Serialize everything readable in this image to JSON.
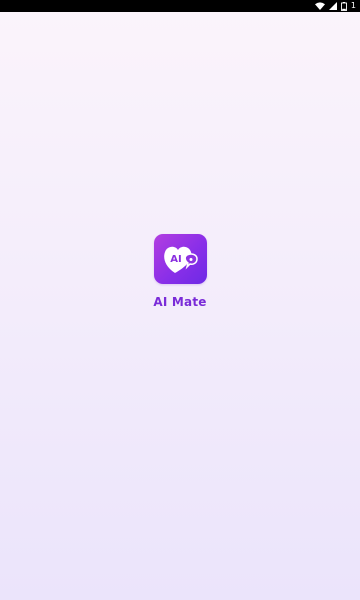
{
  "status_bar": {
    "icons": [
      "wifi-icon",
      "signal-icon",
      "battery-icon"
    ],
    "battery_level": "1"
  },
  "splash": {
    "icon_name": "ai-heart-chat-icon",
    "icon_text": "AI",
    "app_name": "AI Mate"
  },
  "colors": {
    "background_top": "#fbf4fb",
    "background_bottom": "#ebe4fb",
    "accent": "#7a2bd8",
    "icon_gradient_start": "#b23ee0",
    "icon_gradient_end": "#6d2ae6"
  }
}
